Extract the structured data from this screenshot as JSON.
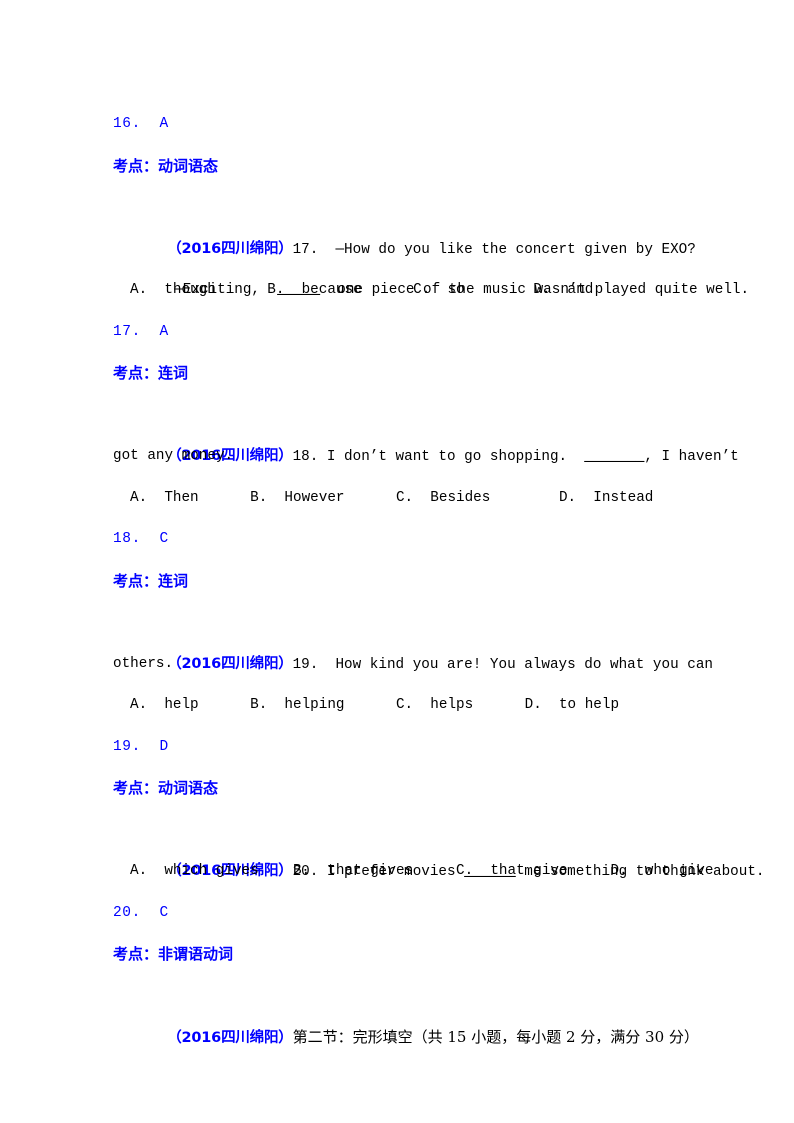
{
  "document": {
    "source_tag": "（2016四川绵阳）",
    "kaodian_label": "考点：",
    "page_bg": "#ffffff",
    "accent_blue": "#0000ff",
    "text_black": "#000000"
  },
  "blocks": [
    {
      "type": "answer",
      "text": "16.  A"
    },
    {
      "type": "kaodian",
      "text": "考点：动词语态"
    },
    {
      "type": "question",
      "tag": "（2016四川绵阳）",
      "body": "17.  —How do you like the concert given by EXO?",
      "cont_lines": [
        "—Exciting,  ____  one piece of the music wasn’t played quite well."
      ],
      "options": "A.  though      B.  because      C.  so        D.  and"
    },
    {
      "type": "answer",
      "text": "17.  A"
    },
    {
      "type": "kaodian",
      "text": "考点：连词"
    },
    {
      "type": "question",
      "tag": "（2016四川绵阳）",
      "body": "18. I don’t want to go shopping.  ______,  I haven’t",
      "cont_lines": [
        "got any money."
      ],
      "options": "A.  Then      B.  However      C.  Besides        D.  Instead"
    },
    {
      "type": "answer",
      "text": "18.  C"
    },
    {
      "type": "kaodian",
      "text": "考点：连词"
    },
    {
      "type": "question",
      "tag": "（2016四川绵阳）",
      "body": "19.  How kind you are! You always do what you can",
      "cont_lines": [
        "others."
      ],
      "options": "A.  help      B.  helping      C.  helps      D.  to help"
    },
    {
      "type": "answer",
      "text": "19.  D"
    },
    {
      "type": "kaodian",
      "text": "考点：动词语态"
    },
    {
      "type": "question",
      "tag": "（2016四川绵阳）",
      "body": "20. I prefer movies ______ me something to think about.",
      "cont_lines": [],
      "options": "A.  which gives    B.  that gives     C.  that give     D.  who give"
    },
    {
      "type": "answer",
      "text": "20.  C"
    },
    {
      "type": "kaodian",
      "text": "考点：非谓语动词"
    },
    {
      "type": "section",
      "tag": "（2016四川绵阳）",
      "body": "第二节：完形填空（共 15 小题，每小题 2 分，满分 30 分）"
    }
  ],
  "lines": {
    "l1_answer16": "16.  A",
    "l2_kaodian": "考点：动词语态",
    "l3_tag": "（2016四川绵阳）",
    "l3_body": "17.  —How do you like the concert given by EXO?",
    "l4_body": "—Exciting,",
    "l4_blank": "_____",
    "l4_rest": "one piece of the music wasn’t played quite well.",
    "l5_opts": "A.  though      B.  because      C.  so        D.  and",
    "l6_answer17": "17.  A",
    "l7_kaodian": "考点：连词",
    "l8_tag": "（2016四川绵阳）",
    "l8_body_a": "18. I don’t want to go shopping.",
    "l8_blank": "_______",
    "l8_body_b": ", I haven’t",
    "l9_cont": "got any money.",
    "l10_opts": "A.  Then      B.  However      C.  Besides        D.  Instead",
    "l11_answer18": "18.  C",
    "l12_kaodian": "考点：连词",
    "l13_tag": "（2016四川绵阳）",
    "l13_body": "19.  How kind you are! You always do what you can",
    "l14_cont": "others.",
    "l15_opts": "A.  help      B.  helping      C.  helps      D.  to help",
    "l16_answer19": "19.  D",
    "l17_kaodian": "考点：动词语态",
    "l18_tag": "（2016四川绵阳）",
    "l18_body_a": "20. I prefer movies",
    "l18_blank": "______",
    "l18_body_b": "me something to think about.",
    "l19_opts": "A.  which gives    B.  that gives     C.  that give     D.  who give",
    "l20_answer20": "20.  C",
    "l21_kaodian": "考点：非谓语动词",
    "l22_tag": "（2016四川绵阳）",
    "l22_body": "第二节：完形填空（共 15 小题，每小题 2 分，满分 30 分）"
  }
}
